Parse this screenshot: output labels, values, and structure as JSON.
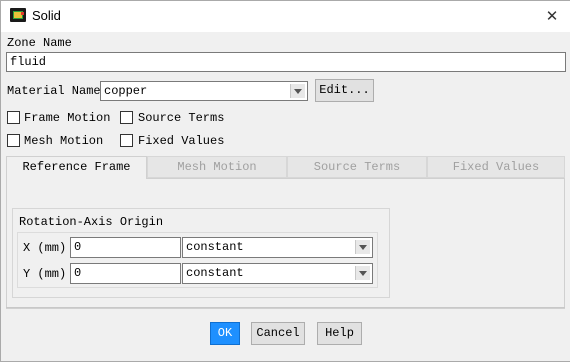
{
  "window": {
    "title": "Solid",
    "close_glyph": "✕"
  },
  "zone": {
    "label": "Zone Name",
    "value": "fluid"
  },
  "material": {
    "label": "Material Name",
    "value": "copper",
    "edit_label": "Edit..."
  },
  "options": {
    "frame_motion": {
      "label": "Frame Motion",
      "checked": false
    },
    "source_terms": {
      "label": "Source Terms",
      "checked": false
    },
    "mesh_motion": {
      "label": "Mesh Motion",
      "checked": false
    },
    "fixed_values": {
      "label": "Fixed Values",
      "checked": false
    }
  },
  "tabs": [
    {
      "label": "Reference Frame",
      "active": true
    },
    {
      "label": "Mesh Motion",
      "active": false
    },
    {
      "label": "Source Terms",
      "active": false
    },
    {
      "label": "Fixed Values",
      "active": false
    }
  ],
  "rotation_origin": {
    "title": "Rotation-Axis Origin",
    "rows": [
      {
        "label": "X (mm)",
        "value": "0",
        "method": "constant"
      },
      {
        "label": "Y (mm)",
        "value": "0",
        "method": "constant"
      }
    ]
  },
  "footer": {
    "ok_label": "OK",
    "cancel_label": "Cancel",
    "help_label": "Help"
  },
  "colors": {
    "ok_button": "#1e90ff",
    "background": "#f0f0f0",
    "inactive_tab_text": "#a0a0a0"
  }
}
